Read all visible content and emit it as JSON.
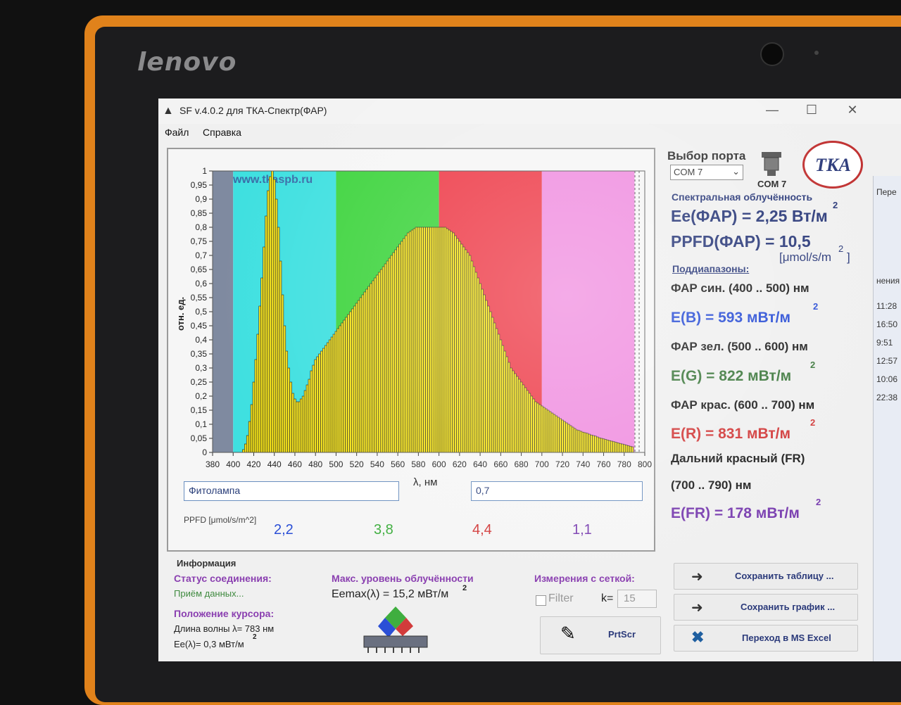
{
  "device": {
    "brand": "lenovo"
  },
  "window": {
    "title": "SF v.4.0.2 для ТКА-Спектр(ФАР)",
    "minimize": "—",
    "maximize": "☐",
    "close": "✕"
  },
  "menu": [
    "Файл",
    "Справка"
  ],
  "chart_data": {
    "type": "bar",
    "watermark": "www.tkaspb.ru",
    "xlabel": "λ, нм",
    "ylabel": "отн. ед.",
    "xlim": [
      380,
      800
    ],
    "ylim": [
      0,
      1
    ],
    "x_ticks": [
      380,
      400,
      420,
      440,
      460,
      480,
      500,
      520,
      540,
      560,
      580,
      600,
      620,
      640,
      660,
      680,
      700,
      720,
      740,
      760,
      780,
      800
    ],
    "y_ticks": [
      "0",
      "0,05",
      "0,1",
      "0,15",
      "0,2",
      "0,25",
      "0,3",
      "0,35",
      "0,4",
      "0,45",
      "0,5",
      "0,55",
      "0,6",
      "0,65",
      "0,7",
      "0,75",
      "0,8",
      "0,85",
      "0,9",
      "0,95",
      "1"
    ],
    "bands": [
      {
        "from": 380,
        "to": 400,
        "color": "#7f8aa0"
      },
      {
        "from": 400,
        "to": 500,
        "color": "#3fe0e0"
      },
      {
        "from": 500,
        "to": 600,
        "color": "#3ed43e"
      },
      {
        "from": 600,
        "to": 700,
        "color": "#ee3d4a"
      },
      {
        "from": 700,
        "to": 790,
        "color": "#f08fe0"
      }
    ],
    "bar_color": "#f2e018",
    "x": [
      410,
      412,
      414,
      416,
      418,
      420,
      422,
      424,
      426,
      428,
      430,
      432,
      434,
      436,
      438,
      440,
      442,
      444,
      446,
      448,
      450,
      452,
      454,
      456,
      458,
      460,
      462,
      464,
      466,
      468,
      470,
      472,
      474,
      476,
      478,
      480,
      482,
      484,
      486,
      488,
      490,
      492,
      494,
      496,
      498,
      500,
      502,
      504,
      506,
      508,
      510,
      512,
      514,
      516,
      518,
      520,
      522,
      524,
      526,
      528,
      530,
      532,
      534,
      536,
      538,
      540,
      542,
      544,
      546,
      548,
      550,
      552,
      554,
      556,
      558,
      560,
      562,
      564,
      566,
      568,
      570,
      572,
      574,
      576,
      578,
      580,
      582,
      584,
      586,
      588,
      590,
      592,
      594,
      596,
      598,
      600,
      602,
      604,
      606,
      608,
      610,
      612,
      614,
      616,
      618,
      620,
      622,
      624,
      626,
      628,
      630,
      632,
      634,
      636,
      638,
      640,
      642,
      644,
      646,
      648,
      650,
      652,
      654,
      656,
      658,
      660,
      662,
      664,
      666,
      668,
      670,
      672,
      674,
      676,
      678,
      680,
      682,
      684,
      686,
      688,
      690,
      692,
      694,
      696,
      698,
      700,
      702,
      704,
      706,
      708,
      710,
      712,
      714,
      716,
      718,
      720,
      722,
      724,
      726,
      728,
      730,
      732,
      734,
      736,
      738,
      740,
      742,
      744,
      746,
      748,
      750,
      752,
      754,
      756,
      758,
      760,
      762,
      764,
      766,
      768,
      770,
      772,
      774,
      776,
      778,
      780,
      782,
      784,
      786,
      788
    ],
    "values": [
      0.01,
      0.03,
      0.06,
      0.11,
      0.17,
      0.25,
      0.33,
      0.42,
      0.52,
      0.62,
      0.73,
      0.84,
      0.93,
      0.98,
      1.0,
      0.97,
      0.9,
      0.8,
      0.68,
      0.56,
      0.45,
      0.36,
      0.3,
      0.25,
      0.21,
      0.19,
      0.18,
      0.18,
      0.19,
      0.2,
      0.22,
      0.24,
      0.26,
      0.29,
      0.31,
      0.33,
      0.34,
      0.35,
      0.36,
      0.37,
      0.38,
      0.39,
      0.4,
      0.41,
      0.42,
      0.43,
      0.44,
      0.45,
      0.46,
      0.47,
      0.48,
      0.49,
      0.5,
      0.51,
      0.52,
      0.53,
      0.54,
      0.55,
      0.56,
      0.57,
      0.58,
      0.59,
      0.6,
      0.61,
      0.62,
      0.63,
      0.64,
      0.65,
      0.66,
      0.67,
      0.68,
      0.69,
      0.7,
      0.71,
      0.72,
      0.73,
      0.74,
      0.75,
      0.76,
      0.77,
      0.78,
      0.785,
      0.79,
      0.795,
      0.8,
      0.8,
      0.8,
      0.8,
      0.8,
      0.8,
      0.8,
      0.8,
      0.8,
      0.8,
      0.8,
      0.8,
      0.8,
      0.8,
      0.8,
      0.795,
      0.79,
      0.785,
      0.78,
      0.77,
      0.76,
      0.75,
      0.74,
      0.73,
      0.72,
      0.71,
      0.7,
      0.68,
      0.66,
      0.64,
      0.62,
      0.6,
      0.58,
      0.56,
      0.54,
      0.52,
      0.5,
      0.48,
      0.46,
      0.44,
      0.42,
      0.4,
      0.38,
      0.36,
      0.34,
      0.32,
      0.3,
      0.29,
      0.28,
      0.27,
      0.26,
      0.25,
      0.24,
      0.23,
      0.22,
      0.21,
      0.2,
      0.19,
      0.18,
      0.175,
      0.17,
      0.165,
      0.16,
      0.155,
      0.15,
      0.145,
      0.14,
      0.135,
      0.13,
      0.125,
      0.12,
      0.115,
      0.11,
      0.105,
      0.1,
      0.095,
      0.09,
      0.085,
      0.08,
      0.078,
      0.075,
      0.072,
      0.07,
      0.068,
      0.065,
      0.062,
      0.06,
      0.058,
      0.055,
      0.052,
      0.05,
      0.048,
      0.046,
      0.044,
      0.042,
      0.04,
      0.038,
      0.036,
      0.034,
      0.032,
      0.03,
      0.028,
      0.026,
      0.024,
      0.022,
      0.02
    ]
  },
  "inputs": {
    "label_field": "Фитолампа",
    "value_field": "0,7"
  },
  "ppfd": {
    "label": "PPFD [μmol/s/m^2]",
    "values": [
      {
        "value": "2,2",
        "color": "#2b4fd6"
      },
      {
        "value": "3,8",
        "color": "#3fae3f"
      },
      {
        "value": "4,4",
        "color": "#d23b3b"
      },
      {
        "value": "1,1",
        "color": "#7a3fb0"
      }
    ]
  },
  "port": {
    "title": "Выбор порта",
    "selected": "COM 7",
    "indicator": "COM 7"
  },
  "irradiance": {
    "title": "Спектральная облучённость",
    "ee": "Ee(ФАР) = 2,25 Вт/м",
    "ppfd": "PPFD(ФАР) = 10,5",
    "ppfd_unit": "[μmol/s/m",
    "ppfd_unit_end": "]",
    "subranges_title": "Поддиапазоны:",
    "blue_label": "ФАР син. (400 .. 500) нм",
    "blue_value": "E(B) = 593 мВт/м",
    "green_label": "ФАР зел. (500 .. 600) нм",
    "green_value": "E(G) = 822 мВт/м",
    "red_label": "ФАР крас. (600 .. 700) нм",
    "red_value": "E(R) = 831 мВт/м",
    "fr_label": "Дальний красный (FR)",
    "fr_range": "(700 .. 790) нм",
    "fr_value": "E(FR) = 178 мВт/м",
    "superscript": "2",
    "colors": {
      "blue": "#2b4fd6",
      "green": "#3f7a3f",
      "red": "#d23b3b",
      "fr": "#7a3fb0",
      "title": "#2b3a7a"
    }
  },
  "info": {
    "title": "Информация",
    "conn_title": "Статус соединения:",
    "conn_value": "Приём данных...",
    "cursor_title": "Положение курсора:",
    "cursor_wl": "Длина волны λ= 783 нм",
    "cursor_ee": "Ee(λ)= 0,3 мВт/м",
    "max_title": "Макс. уровень облучённости",
    "max_value": "Eemax(λ) = 15,2 мВт/м",
    "grid_title": "Измерения с сеткой:",
    "filter_label": "Filter",
    "k_label": "k=",
    "k_value": "15"
  },
  "buttons": {
    "prtscr": "PrtScr",
    "save_table": "Сохранить таблицу ...",
    "save_graph": "Сохранить график ...",
    "excel": "Переход в MS Excel"
  },
  "side_window": {
    "items": [
      "Пере",
      "нения",
      "11:28",
      "16:50",
      "9:51",
      "12:57",
      "10:06",
      "22:38"
    ]
  }
}
